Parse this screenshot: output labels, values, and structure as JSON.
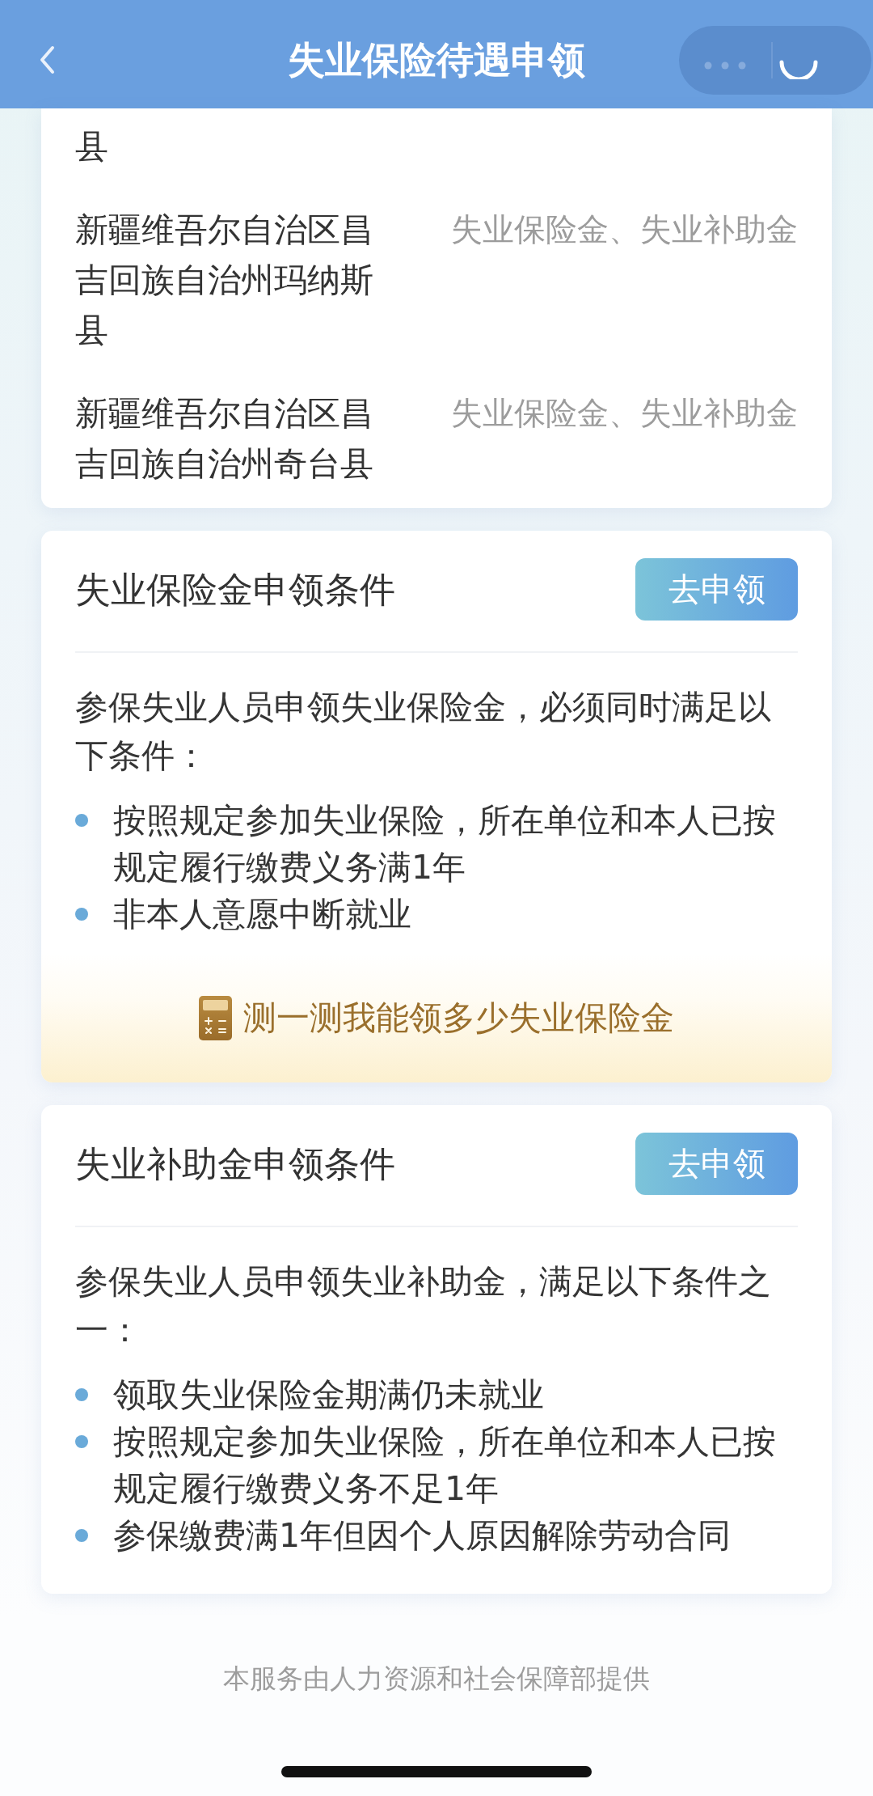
{
  "header": {
    "title": "失业保险待遇申领"
  },
  "region_list": {
    "rows": [
      {
        "place": "县"
      },
      {
        "place": "新疆维吾尔自治区昌吉回族自治州玛纳斯县",
        "benefits": "失业保险金、失业补助金"
      },
      {
        "place": "新疆维吾尔自治区昌吉回族自治州奇台县",
        "benefits": "失业保险金、失业补助金"
      }
    ]
  },
  "condition_cards": [
    {
      "title": "失业保险金申领条件",
      "button": "去申领",
      "intro": "参保失业人员申领失业保险金，必须同时满足以下条件：",
      "items": [
        "按照规定参加失业保险，所在单位和本人已按规定履行缴费义务满1年",
        "非本人意愿中断就业"
      ],
      "link": "测一测我能领多少失业保险金"
    },
    {
      "title": "失业补助金申领条件",
      "button": "去申领",
      "intro": "参保失业人员申领失业补助金，满足以下条件之一：",
      "items": [
        "领取失业保险金期满仍未就业",
        "按照规定参加失业保险，所在单位和本人已按规定履行缴费义务不足1年",
        "参保缴费满1年但因个人原因解除劳动合同"
      ]
    }
  ],
  "footer": "本服务由人力资源和社会保障部提供"
}
